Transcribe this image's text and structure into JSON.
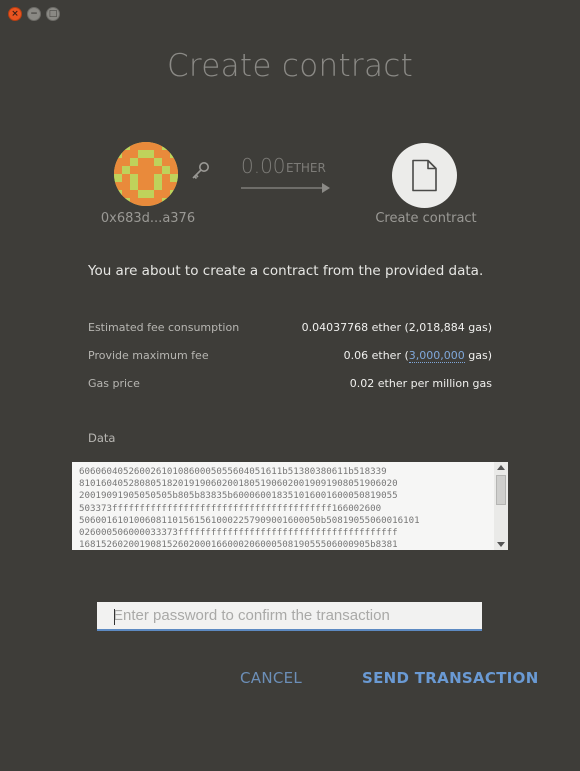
{
  "window": {
    "close_glyph": "×",
    "minimize_glyph": "−",
    "maximize_glyph": "□"
  },
  "title": "Create contract",
  "from": {
    "address": "0x683d...a376",
    "avatar_icon": "identicon",
    "key_icon": "key-icon"
  },
  "transfer": {
    "amount": "0.00",
    "unit": "ETHER"
  },
  "to": {
    "label": "Create contract",
    "icon": "document-icon"
  },
  "intro_text": "You are about to create a contract from the provided data.",
  "details": {
    "fee_label": "Estimated fee consumption",
    "fee_value": "0.04037768 ether (2,018,884 gas)",
    "max_fee_label": "Provide maximum fee",
    "max_fee_prefix": "0.06 ether (",
    "max_fee_gas": "3,000,000",
    "max_fee_suffix": " gas)",
    "gas_price_label": "Gas price",
    "gas_price_value": "0.02 ether per million gas"
  },
  "data_label": "Data",
  "data_lines": [
    "6060604052600261010860005055604051611b51380380611b518339",
    "8101604052808051820191906020018051906020019091908051906020",
    "20019091905050505b805b83835b600060018351016001600050819055",
    "503373ffffffffffffffffffffffffffffffffffffffff166002600",
    "50600161010060811015615610002257909001600050b50819055060016101",
    "026000506000033373ffffffffffffffffffffffffffffffffffffffff",
    "16815260200190815260200016600020600050819055506000905b8381"
  ],
  "password": {
    "placeholder": "Enter password to confirm the transaction",
    "value": ""
  },
  "buttons": {
    "cancel": "CANCEL",
    "send": "SEND TRANSACTION"
  },
  "colors": {
    "background": "#3e3d39",
    "accent": "#6a9ad4",
    "close_button": "#e95420"
  }
}
